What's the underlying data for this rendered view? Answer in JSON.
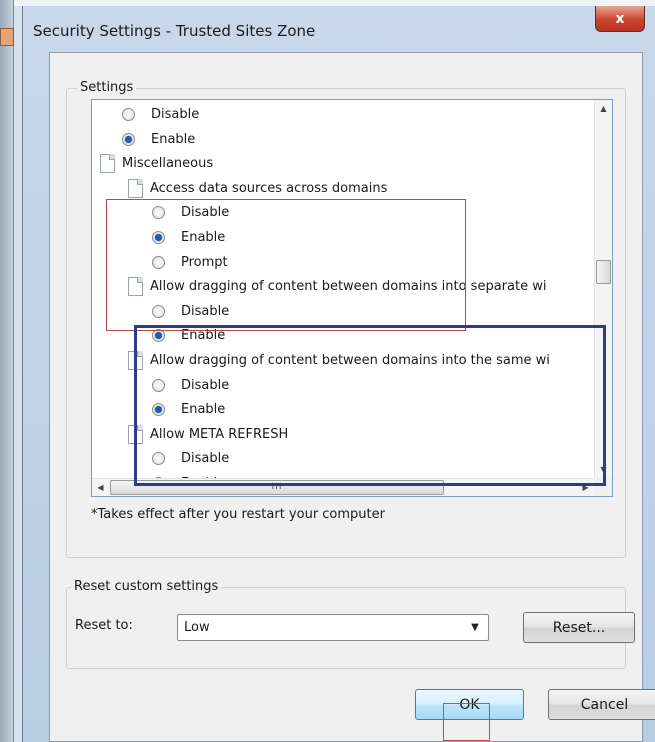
{
  "window": {
    "title": "Security Settings - Trusted Sites Zone",
    "close_label": "x"
  },
  "settings": {
    "group_label": "Settings",
    "rows": [
      {
        "kind": "radio",
        "label": "Disable",
        "checked": false
      },
      {
        "kind": "radio",
        "label": "Enable",
        "checked": true
      },
      {
        "kind": "category",
        "label": "Miscellaneous"
      },
      {
        "kind": "setting",
        "label": "Access data sources across domains"
      },
      {
        "kind": "radio",
        "label": "Disable",
        "checked": false
      },
      {
        "kind": "radio",
        "label": "Enable",
        "checked": true
      },
      {
        "kind": "radio",
        "label": "Prompt",
        "checked": false
      },
      {
        "kind": "setting",
        "label": "Allow dragging of content between domains into separate wi"
      },
      {
        "kind": "radio",
        "label": "Disable",
        "checked": false
      },
      {
        "kind": "radio",
        "label": "Enable",
        "checked": true
      },
      {
        "kind": "setting",
        "label": "Allow dragging of content between domains into the same wi"
      },
      {
        "kind": "radio",
        "label": "Disable",
        "checked": false
      },
      {
        "kind": "radio",
        "label": "Enable",
        "checked": true
      },
      {
        "kind": "setting",
        "label": "Allow META REFRESH"
      },
      {
        "kind": "radio",
        "label": "Disable",
        "checked": false
      },
      {
        "kind": "radio",
        "label": "Enable",
        "checked": true
      }
    ],
    "hscroll_grip": "III",
    "footnote": "*Takes effect after you restart your computer"
  },
  "reset": {
    "group_label": "Reset custom settings",
    "reset_to_label": "Reset to:",
    "selected_level": "Low",
    "reset_button": "Reset..."
  },
  "buttons": {
    "ok": "OK",
    "cancel": "Cancel"
  },
  "annotations": {
    "red_box_color": "#b34a4a",
    "blue_box_color": "#2f3a8a"
  }
}
